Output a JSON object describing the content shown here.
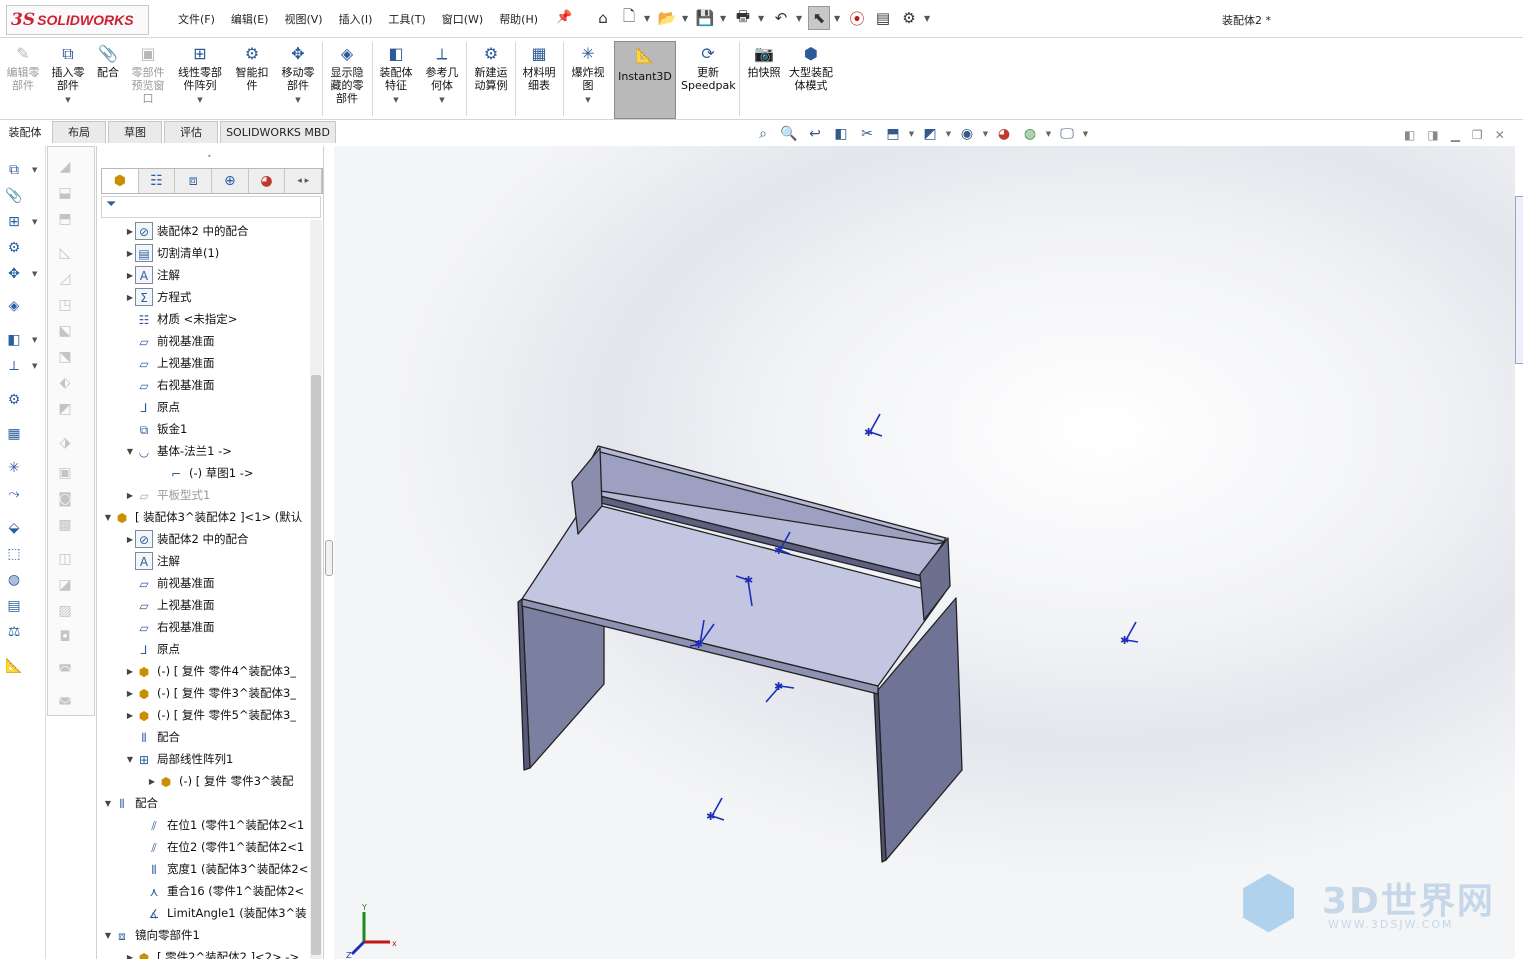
{
  "app": {
    "brand_ds": "3S",
    "brand_name": "SOLIDWORKS",
    "document_title": "装配体2 *"
  },
  "menu": [
    "文件(F)",
    "编辑(E)",
    "视图(V)",
    "插入(I)",
    "工具(T)",
    "窗口(W)",
    "帮助(H)"
  ],
  "ribbon": {
    "edit_component": "编辑零部件",
    "insert_component": "插入零部件",
    "mate": "配合",
    "component_preview": "零部件预览窗口",
    "linear_pattern": "线性零部件阵列",
    "smart_fasteners": "智能扣件",
    "move_component": "移动零部件",
    "show_hidden": "显示隐藏的零部件",
    "assembly_features": "装配体特征",
    "reference_geometry": "参考几何体",
    "new_motion_study": "新建运动算例",
    "bom": "材料明细表",
    "exploded_view": "爆炸视图",
    "instant3d": "Instant3D",
    "speedpak": "更新Speedpak",
    "snapshot": "拍快照",
    "large_assembly": "大型装配体模式"
  },
  "tabs": [
    "装配体",
    "布局",
    "草图",
    "评估",
    "SOLIDWORKS MBD"
  ],
  "tree": [
    {
      "label": "装配体2 中的配合",
      "icon": "mates-folder-icon"
    },
    {
      "label": "切割清单(1)",
      "icon": "cut-list-icon"
    },
    {
      "label": "注解",
      "icon": "annotations-icon"
    },
    {
      "label": "方程式",
      "icon": "equations-icon"
    },
    {
      "label": "材质 <未指定>",
      "icon": "material-icon"
    },
    {
      "label": "前视基准面",
      "icon": "plane-icon"
    },
    {
      "label": "上视基准面",
      "icon": "plane-icon"
    },
    {
      "label": "右视基准面",
      "icon": "plane-icon"
    },
    {
      "label": "原点",
      "icon": "origin-icon"
    },
    {
      "label": "钣金1",
      "icon": "sheet-metal-icon"
    },
    {
      "label": "基体-法兰1 ->",
      "icon": "base-flange-icon"
    },
    {
      "label": "(-) 草图1 ->",
      "icon": "sketch-icon"
    },
    {
      "label": "平板型式1",
      "icon": "flat-pattern-icon"
    },
    {
      "label": "[ 装配体3^装配体2 ]<1> (默认",
      "icon": "subassembly-icon"
    },
    {
      "label": "装配体2 中的配合",
      "icon": "mates-folder-icon"
    },
    {
      "label": "注解",
      "icon": "annotations-icon"
    },
    {
      "label": "前视基准面",
      "icon": "plane-icon"
    },
    {
      "label": "上视基准面",
      "icon": "plane-icon"
    },
    {
      "label": "右视基准面",
      "icon": "plane-icon"
    },
    {
      "label": "原点",
      "icon": "origin-icon"
    },
    {
      "label": "(-) [ 复件 零件4^装配体3_",
      "icon": "part-icon"
    },
    {
      "label": "(-) [ 复件 零件3^装配体3_",
      "icon": "part-icon"
    },
    {
      "label": "(-) [ 复件 零件5^装配体3_",
      "icon": "part-icon"
    },
    {
      "label": "配合",
      "icon": "mate-icon"
    },
    {
      "label": "局部线性阵列1",
      "icon": "linear-pattern-icon"
    },
    {
      "label": "(-) [ 复件 零件3^装配",
      "icon": "part-icon"
    },
    {
      "label": "配合",
      "icon": "mate-icon"
    },
    {
      "label": "在位1 (零件1^装配体2<1",
      "icon": "inplace-icon"
    },
    {
      "label": "在位2 (零件1^装配体2<1",
      "icon": "inplace-icon"
    },
    {
      "label": "宽度1 (装配体3^装配体2<",
      "icon": "width-mate-icon"
    },
    {
      "label": "重合16 (零件1^装配体2<",
      "icon": "coincident-icon"
    },
    {
      "label": "LimitAngle1 (装配体3^装",
      "icon": "limit-angle-icon"
    },
    {
      "label": "镜向零部件1",
      "icon": "mirror-component-icon"
    },
    {
      "label": "[ 零件2^装配体2 ]<2> ->",
      "icon": "part-icon"
    }
  ],
  "triad": {
    "x": "x",
    "y": "Y",
    "z": "Z"
  },
  "watermark": {
    "title": "3D世界网",
    "url": "WWW.3DSJW.COM"
  }
}
